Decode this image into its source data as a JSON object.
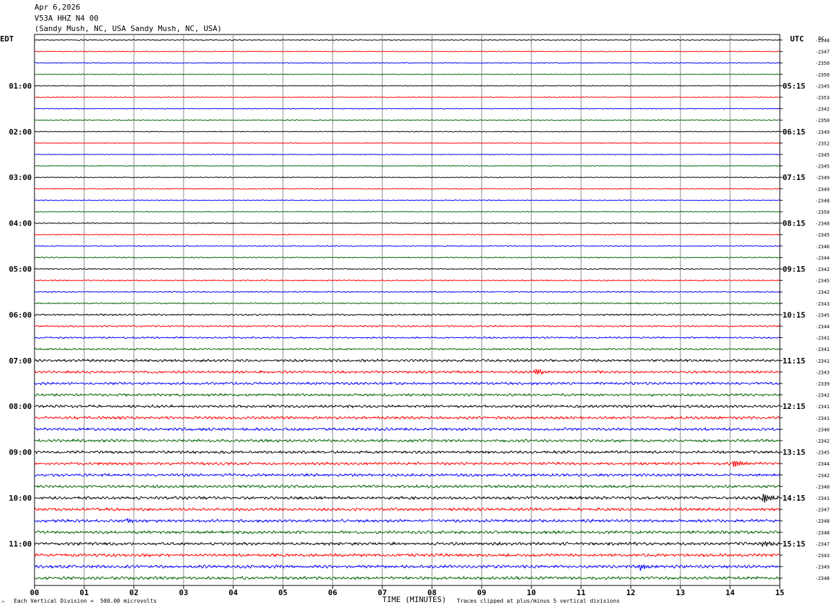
{
  "header": {
    "date": "Apr 6,2026",
    "station": "V53A HHZ N4 00",
    "location": "(Sandy Mush, NC, USA Sandy Mush, NC, USA)"
  },
  "left_tz": "EDT",
  "right_tz": "UTC",
  "dc_label": "DC",
  "footer": {
    "scale": "Each Vertical Division =  500.00 microvolts",
    "clip": "Traces clipped at plus/minus 5 vertical divisions",
    "corner_mark": "^"
  },
  "chart_data": {
    "type": "line",
    "xlabel": "TIME (MINUTES)",
    "xlim": [
      0,
      15
    ],
    "x_ticks": [
      "00",
      "01",
      "02",
      "03",
      "04",
      "05",
      "06",
      "07",
      "08",
      "09",
      "10",
      "11",
      "12",
      "13",
      "14",
      "15"
    ],
    "trace_colors": [
      "#000000",
      "#ff0000",
      "#0000ff",
      "#006400"
    ],
    "left_hour_labels": [
      "01:00",
      "02:00",
      "03:00",
      "04:00",
      "05:00",
      "06:00",
      "07:00",
      "08:00",
      "09:00",
      "10:00",
      "11:00"
    ],
    "right_hour_labels": [
      "05:15",
      "06:15",
      "07:15",
      "08:15",
      "09:15",
      "10:15",
      "11:15",
      "12:15",
      "13:15",
      "14:15",
      "15:15"
    ],
    "dc_values": [
      "2348",
      "2347",
      "2350",
      "2350",
      "2345",
      "2353",
      "2342",
      "2350",
      "2349",
      "2352",
      "2345",
      "2345",
      "2349",
      "2349",
      "2348",
      "2350",
      "2348",
      "2345",
      "2346",
      "2344",
      "2342",
      "2345",
      "2342",
      "2343",
      "2345",
      "2344",
      "2341",
      "2341",
      "2341",
      "2343",
      "2339",
      "2342",
      "2341",
      "2341",
      "2340",
      "2342",
      "2345",
      "2344",
      "2342",
      "2340",
      "2341",
      "2347",
      "2348",
      "2348",
      "2347",
      "2343",
      "2349",
      "2348"
    ],
    "noise_levels": [
      0.4,
      0.4,
      0.4,
      0.4,
      0.4,
      0.4,
      0.4,
      0.4,
      0.4,
      0.4,
      0.4,
      0.4,
      0.4,
      0.4,
      0.4,
      0.4,
      0.5,
      0.5,
      0.5,
      0.5,
      0.5,
      0.6,
      0.6,
      0.6,
      0.8,
      0.8,
      0.8,
      0.8,
      1.2,
      1.2,
      1.2,
      1.2,
      1.3,
      1.3,
      1.3,
      1.3,
      1.3,
      1.3,
      1.3,
      1.3,
      1.4,
      1.4,
      1.4,
      1.4,
      1.4,
      1.4,
      1.4,
      1.4
    ],
    "events": [
      {
        "trace": 29,
        "minute": 10.1,
        "amplitude": 5
      },
      {
        "trace": 37,
        "minute": 14.1,
        "amplitude": 6
      },
      {
        "trace": 40,
        "minute": 14.7,
        "amplitude": 8
      },
      {
        "trace": 42,
        "minute": 1.9,
        "amplitude": 3
      },
      {
        "trace": 44,
        "minute": 14.7,
        "amplitude": 5
      },
      {
        "trace": 46,
        "minute": 12.2,
        "amplitude": 5
      }
    ]
  }
}
